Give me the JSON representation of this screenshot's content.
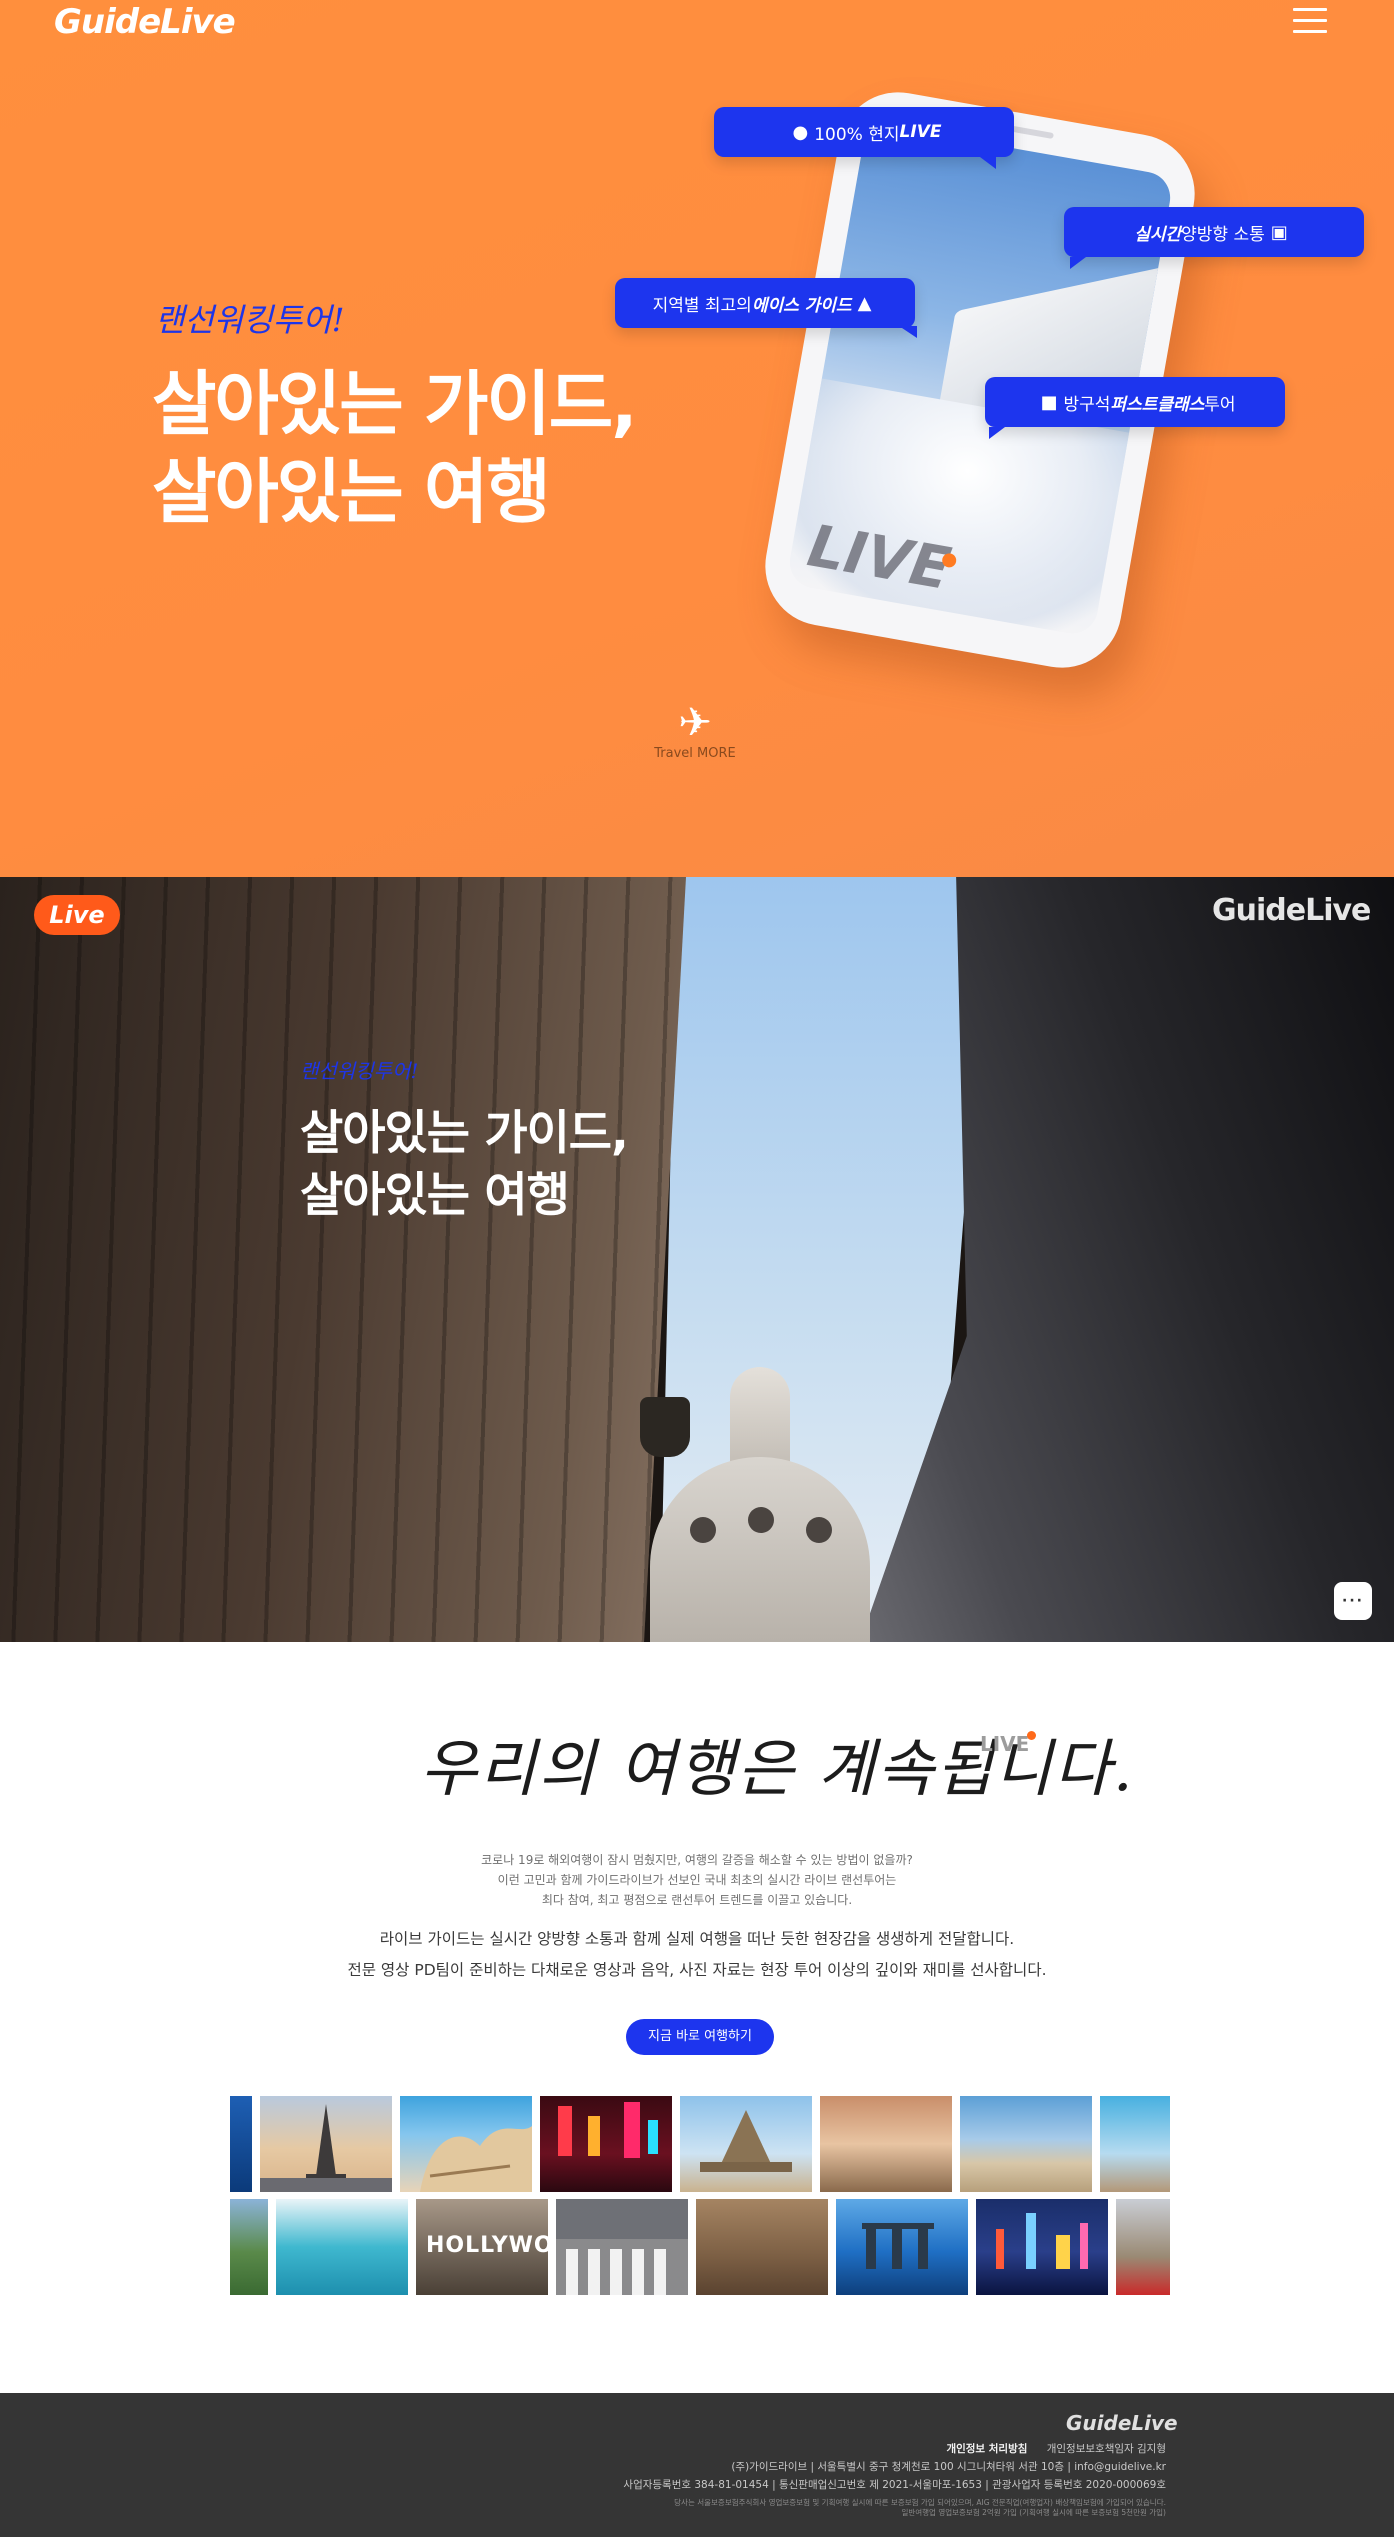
{
  "header": {
    "logo": "GuideLive",
    "menu_icon": "hamburger-icon"
  },
  "hero": {
    "subtitle": "랜선워킹투어!",
    "title_line1": "살아있는 가이드,",
    "title_line2": "살아있는 여행",
    "phone_text": "LIVE",
    "bubbles": [
      {
        "pre": "100% 현지 ",
        "emph": "LIVE",
        "post": "",
        "icon": "map-pin-icon"
      },
      {
        "pre": "",
        "emph": "실시간",
        "post": " 양방향 소통",
        "icon": "chat-icon"
      },
      {
        "pre": "지역별 최고의 ",
        "emph": "에이스 가이드",
        "post": "",
        "icon": "thumbs-up-icon"
      },
      {
        "pre": " 방구석 ",
        "emph": "퍼스트클래스",
        "post": " 투어",
        "icon": "seat-icon"
      }
    ],
    "travel_more": "Travel MORE"
  },
  "video": {
    "badge": "Live",
    "logo": "GuideLive",
    "subtitle": "랜선워킹투어!",
    "title_line1": "살아있는 가이드,",
    "title_line2": "살아있는 여행",
    "chat_button": "···"
  },
  "intro": {
    "title": "우리의 여행은 계속됩니다.",
    "live_mark": "LIVE",
    "small_text": [
      "코로나 19로 해외여행이 잠시 멈췄지만, 여행의 갈증을 해소할 수 있는 방법이 없을까?",
      "이런 고민과 함께 가이드라이브가 선보인 국내 최초의 실시간 라이브 랜선투어는",
      "최다 참여, 최고 평점으로 랜선투어 트렌드를 이끌고 있습니다."
    ],
    "main_text": [
      "라이브 가이드는 실시간 양방향 소통과 함께 실제 여행을 떠난 듯한 현장감을 생생하게 전달합니다.",
      "전문 영상 PD팀이 준비하는 다채로운 영상과 음악, 사진 자료는 현장 투어 이상의 깊이와 재미를 선사합니다."
    ],
    "cta": "지금 바로 여행하기"
  },
  "gallery": {
    "row1": [
      "ocean-photo",
      "eiffel-tower-photo",
      "gaudi-building-photo",
      "chinatown-night-photo",
      "mont-saint-michel-photo",
      "street-cafe-photo",
      "palace-photo",
      "city-sky-photo"
    ],
    "row2": [
      "green-hills-photo",
      "blue-lagoon-photo",
      "hollywood-sign-photo",
      "crosswalk-photo",
      "alley-photo",
      "marina-bay-photo",
      "night-skyline-photo",
      "london-photo"
    ],
    "hollywood_text": "HOLLYWOOD",
    "colors": {
      "ocean": "#1e5fb4",
      "eiffel": "#d9b48a",
      "gaudi": "#3ea3de",
      "chinatown": "#3a0a12",
      "mont": "#8ec2ea",
      "cafe": "#c98e6a",
      "palace": "#5c9fd6",
      "city": "#47b0e0",
      "green": "#5a8a4a",
      "lagoon": "#3fb8cf",
      "hollywood": "#6e6256",
      "crosswalk": "#8a8a8c",
      "alley": "#a58462",
      "marina": "#1f6fc4",
      "night": "#1a2e6a",
      "london": "#c9cdd4"
    }
  },
  "footer": {
    "logo": "GuideLive",
    "privacy_label": "개인정보 처리방침",
    "privacy_officer": "개인정보보호책임자 김지형",
    "line2": "(주)가이드라이브  |  서울특별시 중구 청계천로 100 시그니쳐타워 서관 10층  |  info@guidelive.kr",
    "line3": "사업자등록번호 384-81-01454  |  통신판매업신고번호 제 2021-서울마포-1653  |  관광사업자 등록번호 2020-000069호",
    "tiny1": "당사는 서울보증보험주식회사 영업보증보험 및 기획여행 실시에 따른 보증보험 가입 되어있으며, AIG 전문직업(여행업자) 배상책임보험에 가입되어 있습니다.",
    "tiny2": "일반여행업 영업보증보험 2억원 가입 (기획여행 실시에 따른 보증보험 5천만원 가입)"
  }
}
